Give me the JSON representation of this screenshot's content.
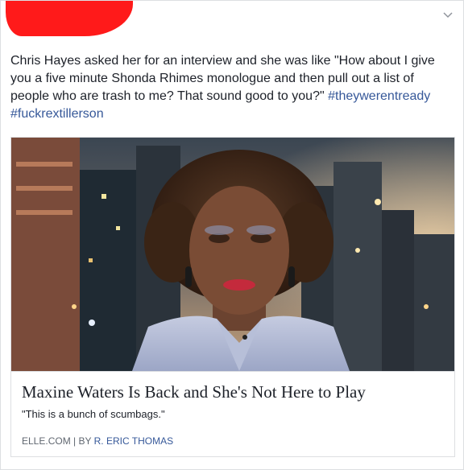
{
  "post": {
    "text": "Chris Hayes asked her for an interview and she was like \"How about I give you a five minute Shonda Rhimes monologue and then pull out a list of people who are trash to me? That sound good to you?\"",
    "hashtags": [
      "#theywerentready",
      "#fuckrextillerson"
    ],
    "options_icon": "chevron-down-icon"
  },
  "link_card": {
    "title": "Maxine Waters Is Back and She's Not Here to Play",
    "description": "\"This is a bunch of scumbags.\"",
    "source_domain": "ELLE.COM",
    "separator": "|",
    "byline_prefix": "BY",
    "author": "R. ERIC THOMAS"
  },
  "colors": {
    "redaction": "#ff1a1a",
    "hashtag_link": "#365899",
    "text": "#1d2129",
    "muted": "#606770",
    "border": "#dddfe2"
  }
}
